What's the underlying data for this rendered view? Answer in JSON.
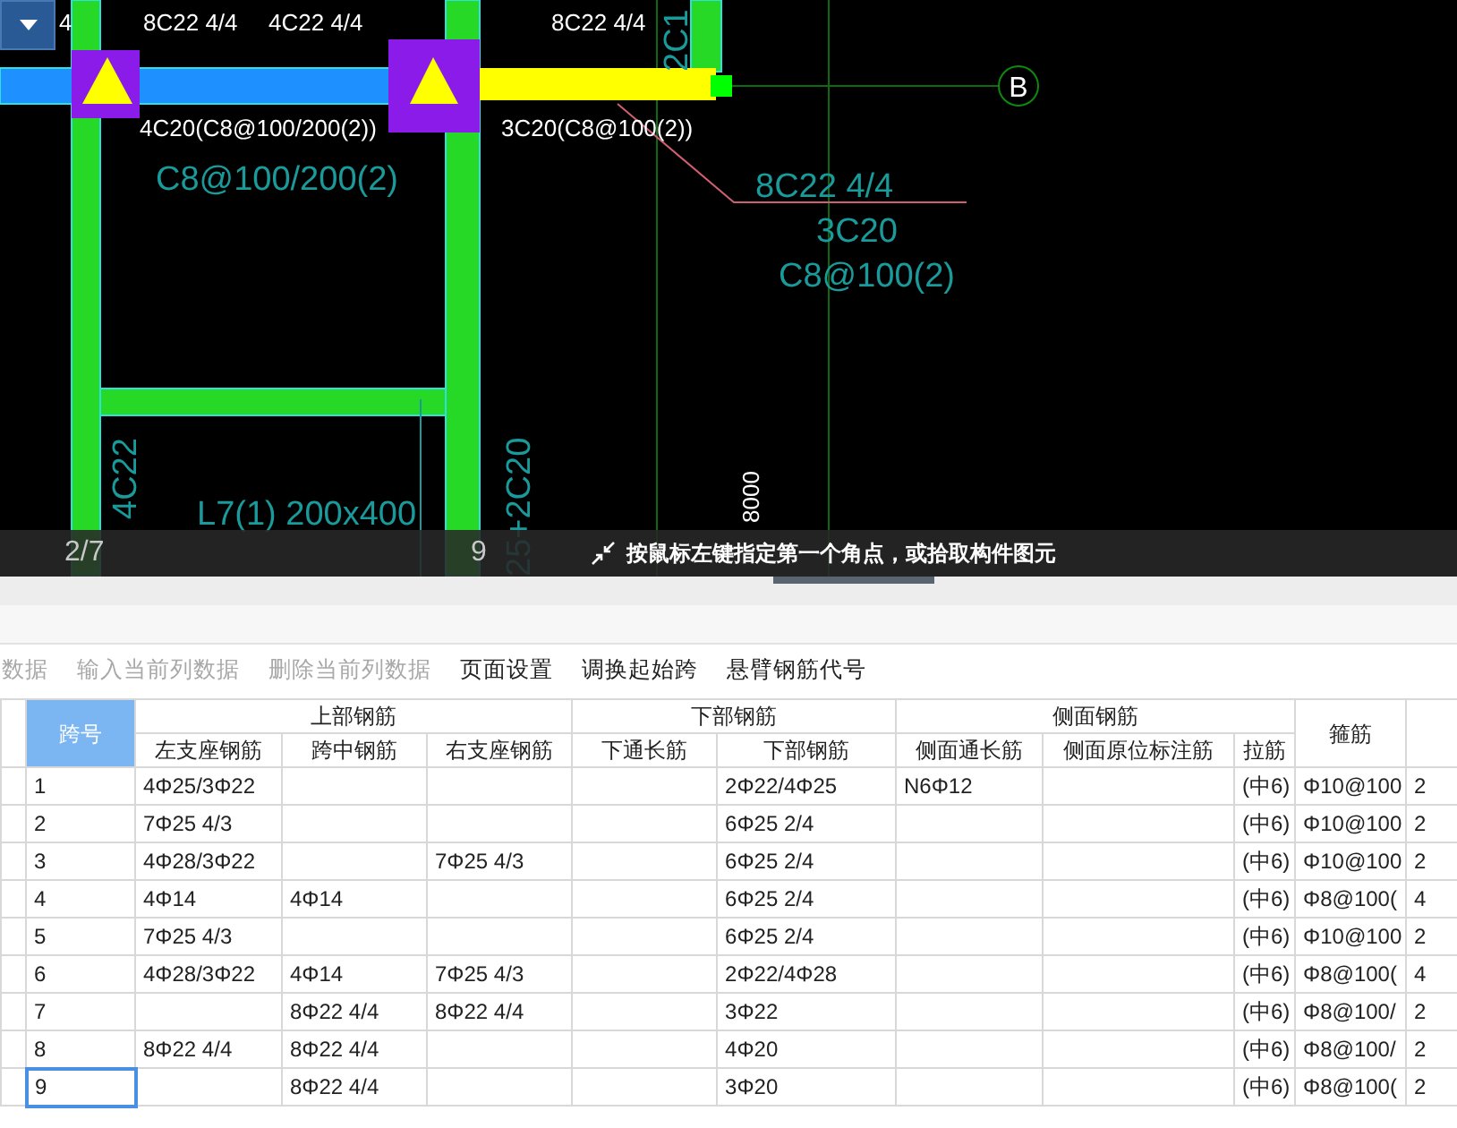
{
  "cad": {
    "dropdown": {
      "expanded": false
    },
    "labels": [
      {
        "kind": "white",
        "text": "4"
      },
      {
        "kind": "white",
        "text": "8C22 4/4"
      },
      {
        "kind": "white",
        "text": "4C22 4/4"
      },
      {
        "kind": "white",
        "text": "8C22 4/4"
      },
      {
        "kind": "white",
        "text": "4C20(C8@100/200(2))"
      },
      {
        "kind": "white",
        "text": "3C20(C8@100(2))"
      },
      {
        "kind": "teal",
        "text": "C8@100/200(2)"
      },
      {
        "kind": "teal",
        "text": "8C22 4/4"
      },
      {
        "kind": "teal",
        "text": "3C20"
      },
      {
        "kind": "teal",
        "text": "C8@100(2)"
      },
      {
        "kind": "teal",
        "text": "L7(1) 200x400"
      },
      {
        "kind": "teal-vertical",
        "text": "4C22"
      },
      {
        "kind": "teal-vertical",
        "text": "25+2C20"
      },
      {
        "kind": "teal-vertical",
        "text": "2C1"
      },
      {
        "kind": "white-vertical",
        "text": "8000"
      }
    ],
    "axes": [
      {
        "text": "B"
      },
      {
        "text": "2/7"
      },
      {
        "text": "9"
      }
    ],
    "hint": "按鼠标左键指定第一个角点，或拾取构件图元"
  },
  "toolbar": [
    {
      "label": "数据",
      "disabled": true
    },
    {
      "label": "输入当前列数据",
      "disabled": true
    },
    {
      "label": "删除当前列数据",
      "disabled": true
    },
    {
      "label": "页面设置",
      "disabled": false
    },
    {
      "label": "调换起始跨",
      "disabled": false
    },
    {
      "label": "悬臂钢筋代号",
      "disabled": false
    }
  ],
  "table": {
    "header": [
      {
        "label": "跨号",
        "selected": true
      },
      {
        "label": "上部钢筋",
        "sub": [
          "左支座钢筋",
          "跨中钢筋",
          "右支座钢筋"
        ]
      },
      {
        "label": "下部钢筋",
        "sub": [
          "下通长筋",
          "下部钢筋"
        ]
      },
      {
        "label": "侧面钢筋",
        "sub": [
          "侧面通长筋",
          "侧面原位标注筋",
          "拉筋"
        ]
      },
      {
        "label": "箍筋"
      }
    ],
    "rows": [
      {
        "selected": false,
        "cells": [
          "1",
          "4Φ25/3Φ22",
          "",
          "",
          "",
          "2Φ22/4Φ25",
          "N6Φ12",
          "",
          "(中6)",
          "Φ10@100",
          "2"
        ]
      },
      {
        "selected": false,
        "cells": [
          "2",
          "7Φ25 4/3",
          "",
          "",
          "",
          "6Φ25 2/4",
          "",
          "",
          "(中6)",
          "Φ10@100",
          "2"
        ]
      },
      {
        "selected": false,
        "cells": [
          "3",
          "4Φ28/3Φ22",
          "",
          "7Φ25 4/3",
          "",
          "6Φ25 2/4",
          "",
          "",
          "(中6)",
          "Φ10@100",
          "2"
        ]
      },
      {
        "selected": false,
        "cells": [
          "4",
          "4Φ14",
          "4Φ14",
          "",
          "",
          "6Φ25 2/4",
          "",
          "",
          "(中6)",
          "Φ8@100(",
          "4"
        ]
      },
      {
        "selected": false,
        "cells": [
          "5",
          "7Φ25 4/3",
          "",
          "",
          "",
          "6Φ25 2/4",
          "",
          "",
          "(中6)",
          "Φ10@100",
          "2"
        ]
      },
      {
        "selected": false,
        "cells": [
          "6",
          "4Φ28/3Φ22",
          "4Φ14",
          "7Φ25 4/3",
          "",
          "2Φ22/4Φ28",
          "",
          "",
          "(中6)",
          "Φ8@100(",
          "4"
        ]
      },
      {
        "selected": false,
        "cells": [
          "7",
          "",
          "8Φ22 4/4",
          "8Φ22 4/4",
          "",
          "3Φ22",
          "",
          "",
          "(中6)",
          "Φ8@100/",
          "2"
        ]
      },
      {
        "selected": false,
        "cells": [
          "8",
          "8Φ22 4/4",
          "8Φ22 4/4",
          "",
          "",
          "4Φ20",
          "",
          "",
          "(中6)",
          "Φ8@100/",
          "2"
        ]
      },
      {
        "selected": true,
        "cells": [
          "9",
          "",
          "8Φ22 4/4",
          "",
          "",
          "3Φ20",
          "",
          "",
          "(中6)",
          "Φ8@100(",
          "2"
        ]
      }
    ]
  }
}
